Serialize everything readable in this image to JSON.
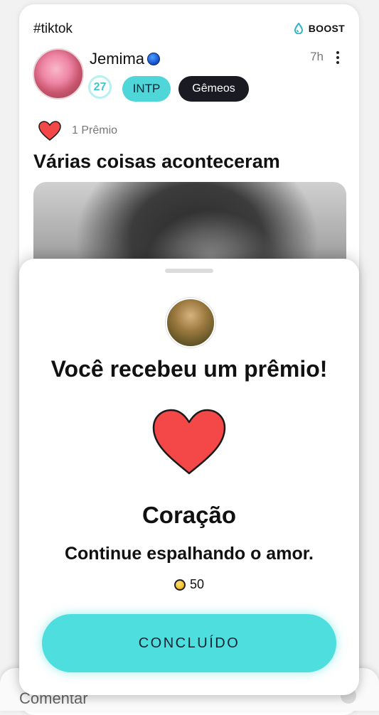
{
  "post": {
    "hashtag": "#tiktok",
    "boost_label": "BOOST",
    "username": "Jemima",
    "time_ago": "7h",
    "age": "27",
    "personality": "INTP",
    "zodiac": "Gêmeos",
    "prize_count_label": "1 Prêmio",
    "title": "Várias coisas aconteceram"
  },
  "comment_bar": {
    "placeholder": "Comentar"
  },
  "award_sheet": {
    "title": "Você recebeu um prêmio!",
    "award_name": "Coração",
    "message": "Continue espalhando o amor.",
    "cost": "50",
    "done_label": "CONCLUÍDO"
  },
  "colors": {
    "accent": "#4fdede",
    "heart": "#f44848",
    "zodiac_badge": "#1a1a22"
  },
  "icons": [
    "boost-drop-icon",
    "globe-icon",
    "more-vert-icon",
    "heart-icon",
    "coin-icon"
  ]
}
